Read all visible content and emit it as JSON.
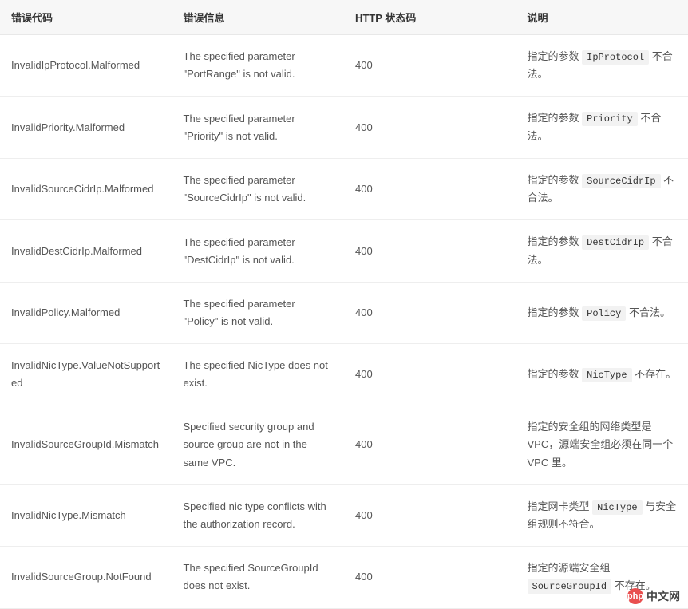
{
  "headers": {
    "code": "错误代码",
    "message": "错误信息",
    "http": "HTTP 状态码",
    "desc": "说明"
  },
  "rows": [
    {
      "code": "InvalidIpProtocol.Malformed",
      "message": "The specified parameter \"PortRange\" is not valid.",
      "http": "400",
      "desc_pre": "指定的参数 ",
      "desc_code": "IpProtocol",
      "desc_post": " 不合法。"
    },
    {
      "code": "InvalidPriority.Malformed",
      "message": "The specified parameter \"Priority\" is not valid.",
      "http": "400",
      "desc_pre": "指定的参数 ",
      "desc_code": "Priority",
      "desc_post": " 不合法。"
    },
    {
      "code": "InvalidSourceCidrIp.Malformed",
      "message": "The specified parameter \"SourceCidrIp\" is not valid.",
      "http": "400",
      "desc_pre": "指定的参数 ",
      "desc_code": "SourceCidrIp",
      "desc_post": " 不合法。"
    },
    {
      "code": "InvalidDestCidrIp.Malformed",
      "message": "The specified parameter \"DestCidrIp\" is not valid.",
      "http": "400",
      "desc_pre": "指定的参数 ",
      "desc_code": "DestCidrIp",
      "desc_post": " 不合法。"
    },
    {
      "code": "InvalidPolicy.Malformed",
      "message": "The specified parameter \"Policy\" is not valid.",
      "http": "400",
      "desc_pre": "指定的参数 ",
      "desc_code": "Policy",
      "desc_post": " 不合法。"
    },
    {
      "code": "InvalidNicType.ValueNotSupported",
      "message": "The specified NicType does not exist.",
      "http": "400",
      "desc_pre": "指定的参数 ",
      "desc_code": "NicType",
      "desc_post": " 不存在。"
    },
    {
      "code": "InvalidSourceGroupId.Mismatch",
      "message": "Specified security group and source group are not in the same VPC.",
      "http": "400",
      "desc_pre": "指定的安全组的网络类型是 VPC，源端安全组必须在同一个 VPC 里。",
      "desc_code": "",
      "desc_post": ""
    },
    {
      "code": "InvalidNicType.Mismatch",
      "message": "Specified nic type conflicts with the authorization record.",
      "http": "400",
      "desc_pre": "指定网卡类型 ",
      "desc_code": "NicType",
      "desc_post": " 与安全组规则不符合。"
    },
    {
      "code": "InvalidSourceGroup.NotFound",
      "message": "The specified SourceGroupId does not exist.",
      "http": "400",
      "desc_pre": "指定的源端安全组 ",
      "desc_code": "SourceGroupId",
      "desc_post": " 不存在。"
    }
  ],
  "logo": {
    "icon": "php",
    "text": "中文网"
  }
}
